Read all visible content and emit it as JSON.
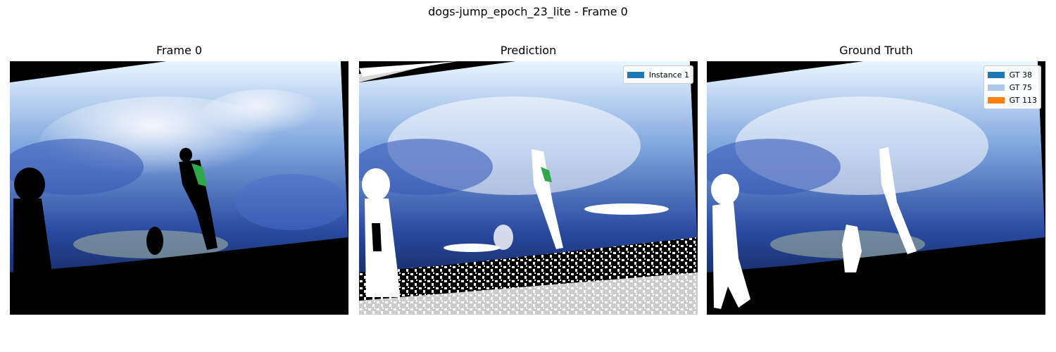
{
  "figure": {
    "title": "dogs-jump_epoch_23_lite - Frame 0"
  },
  "panels": [
    {
      "title": "Frame 0",
      "legend": []
    },
    {
      "title": "Prediction",
      "legend": [
        {
          "label": "Instance 1",
          "color": "#1f77b4"
        }
      ]
    },
    {
      "title": "Ground Truth",
      "legend": [
        {
          "label": "GT 38",
          "color": "#1f77b4"
        },
        {
          "label": "GT 75",
          "color": "#aec7e8"
        },
        {
          "label": "GT 113",
          "color": "#ff7f0e"
        }
      ]
    }
  ]
}
